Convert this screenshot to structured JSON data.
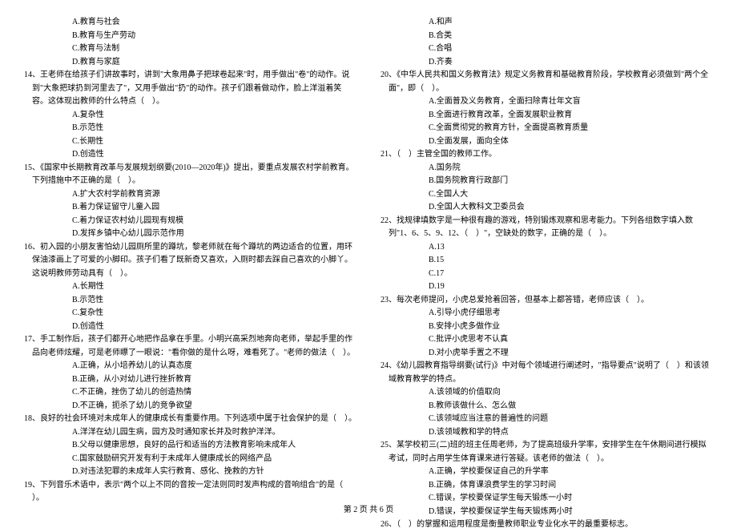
{
  "col1": [
    {
      "cls": "opt",
      "t": "A.教育与社会"
    },
    {
      "cls": "opt",
      "t": "B.教育与生产劳动"
    },
    {
      "cls": "opt",
      "t": "C.教育与法制"
    },
    {
      "cls": "opt",
      "t": "D.教育与家庭"
    },
    {
      "cls": "q",
      "t": "14、王老师在给孩子们讲故事时，讲到\"大象用鼻子把球卷起来\"时，用手做出\"卷\"的动作。说到\"大象把球扔到河里去了\"，又用手做出\"扔\"的动作。孩子们跟着做动作，脸上洋溢着笑容。这体现出教师的什么特点（    ）。"
    },
    {
      "cls": "opt",
      "t": "A.复杂性"
    },
    {
      "cls": "opt",
      "t": "B.示范性"
    },
    {
      "cls": "opt",
      "t": "C.长期性"
    },
    {
      "cls": "opt",
      "t": "D.创造性"
    },
    {
      "cls": "q",
      "t": "15、《国家中长期教育改革与发展规划纲要(2010—2020年)》提出，要重点发展农村学前教育。下列措施中不正确的是（    ）。"
    },
    {
      "cls": "opt",
      "t": "A.扩大农村学前教育资源"
    },
    {
      "cls": "opt",
      "t": "B.着力保证留守儿童入园"
    },
    {
      "cls": "opt",
      "t": "C.着力保证农村幼儿园现有规模"
    },
    {
      "cls": "opt",
      "t": "D.发挥乡镇中心幼儿园示范作用"
    },
    {
      "cls": "q",
      "t": "16、初入园的小朋友害怕幼儿园厕所里的蹲坑，黎老师就在每个蹲坑的两边适合的位置，用环保油漆画上了可爱的小脚印。孩子们看了既新奇又喜欢，入厕时都去踩自己喜欢的小脚丫。这说明教师劳动具有（    ）。"
    },
    {
      "cls": "opt",
      "t": "A.长期性"
    },
    {
      "cls": "opt",
      "t": "B.示范性"
    },
    {
      "cls": "opt",
      "t": "C.复杂性"
    },
    {
      "cls": "opt",
      "t": "D.创造性"
    },
    {
      "cls": "q",
      "t": "17、手工制作后，孩子们都开心地把作品拿在手里。小明兴高采烈地奔向老师，举起手里的作品向老师炫耀，可是老师瞟了一眼说：\"看你做的是什么呀，难看死了。\"老师的做法（    ）。"
    },
    {
      "cls": "opt",
      "t": "A.正确，从小培养幼儿的认真态度"
    },
    {
      "cls": "opt",
      "t": "B.正确，从小对幼儿进行挫折教育"
    },
    {
      "cls": "opt",
      "t": "C.不正确，挫伤了幼儿的创造热情"
    },
    {
      "cls": "opt",
      "t": "D.不正确，扼杀了幼儿的竞争欲望"
    },
    {
      "cls": "q",
      "t": "18、良好的社会环境对未成年人的健康成长有重要作用。下列选项中属于社会保护的是（    ）。"
    },
    {
      "cls": "opt",
      "t": "A.洋洋在幼儿园生病，园方及时通知家长并及时救护洋洋。"
    },
    {
      "cls": "opt",
      "t": "B.父母以健康思想，良好的品行和适当的方法教育影响未成年人"
    },
    {
      "cls": "opt",
      "t": "C.国家鼓励研究开发有利于未成年人健康成长的网络产品"
    },
    {
      "cls": "opt",
      "t": "D.对违法犯罪的未成年人实行教育、感化、挽救的方针"
    },
    {
      "cls": "q",
      "t": "19、下列音乐术语中，表示\"两个以上不同的音按一定法则同时发声构成的音响组合\"的是（    ）。"
    }
  ],
  "col2": [
    {
      "cls": "opt",
      "t": "A.和声"
    },
    {
      "cls": "opt",
      "t": "B.合类"
    },
    {
      "cls": "opt",
      "t": "C.合唱"
    },
    {
      "cls": "opt",
      "t": "D.齐奏"
    },
    {
      "cls": "q",
      "t": "20、《中华人民共和国义务教育法》规定义务教育和基础教育阶段，学校教育必须做到\"两个全面\"，即（    ）。"
    },
    {
      "cls": "opt",
      "t": "A.全面普及义务教育，全面扫除青壮年文盲"
    },
    {
      "cls": "opt",
      "t": "B.全面进行教育改革，全面发展职业教育"
    },
    {
      "cls": "opt",
      "t": "C.全面贯彻党的教育方针，全面提高教育质量"
    },
    {
      "cls": "opt",
      "t": "D.全面发展，面向全体"
    },
    {
      "cls": "q",
      "t": "21、（    ）主管全国的教师工作。"
    },
    {
      "cls": "opt",
      "t": "A.国务院"
    },
    {
      "cls": "opt",
      "t": "B.国务院教育行政部门"
    },
    {
      "cls": "opt",
      "t": "C.全国人大"
    },
    {
      "cls": "opt",
      "t": "D.全国人大教科文卫委员会"
    },
    {
      "cls": "q",
      "t": "22、找规律填数字是一种很有趣的游戏，特别锻炼观察和思考能力。下列各组数字填入数列\"1、6、5、9、12、（    ）\"，空缺处的数字，正确的是（    ）。"
    },
    {
      "cls": "opt",
      "t": "A.13"
    },
    {
      "cls": "opt",
      "t": "B.15"
    },
    {
      "cls": "opt",
      "t": "C.17"
    },
    {
      "cls": "opt",
      "t": "D.19"
    },
    {
      "cls": "q",
      "t": "23、每次老师提问，小虎总爱抢着回答，但基本上都答错，老师应该（    ）。"
    },
    {
      "cls": "opt",
      "t": "A.引导小虎仔细思考"
    },
    {
      "cls": "opt",
      "t": "B.安排小虎多做作业"
    },
    {
      "cls": "opt",
      "t": "C.批评小虎思考不认真"
    },
    {
      "cls": "opt",
      "t": "D.对小虎举手置之不理"
    },
    {
      "cls": "q",
      "t": "24、《幼儿园教育指导纲要(试行)》中对每个领域进行阐述时，\"指导要点\"说明了（    ）和该领域教育教学的特点。"
    },
    {
      "cls": "opt",
      "t": "A.该领域的价值取向"
    },
    {
      "cls": "opt",
      "t": "B.教师该做什么、怎么做"
    },
    {
      "cls": "opt",
      "t": "C.该领域应当注意的普遍性的问题"
    },
    {
      "cls": "opt",
      "t": "D.该领域教和学的特点"
    },
    {
      "cls": "q",
      "t": "25、某学校初三(二)班的班主任周老师，为了提高班级升学率，安排学生在午休期间进行模拟考试，同时占用学生体育课来进行答疑。该老师的做法（    ）。"
    },
    {
      "cls": "opt",
      "t": "A.正确，学校要保证自己的升学率"
    },
    {
      "cls": "opt",
      "t": "B.正确，体育课浪费学生的学习时间"
    },
    {
      "cls": "opt",
      "t": "C.错误，学校要保证学生每天锻炼一小时"
    },
    {
      "cls": "opt",
      "t": "D.错误，学校要保证学生每天锻炼两小时"
    },
    {
      "cls": "q",
      "t": "26、（    ）的掌握和运用程度是衡量教师职业专业化水平的最重要标志。"
    }
  ],
  "footer": "第 2 页 共 6 页"
}
